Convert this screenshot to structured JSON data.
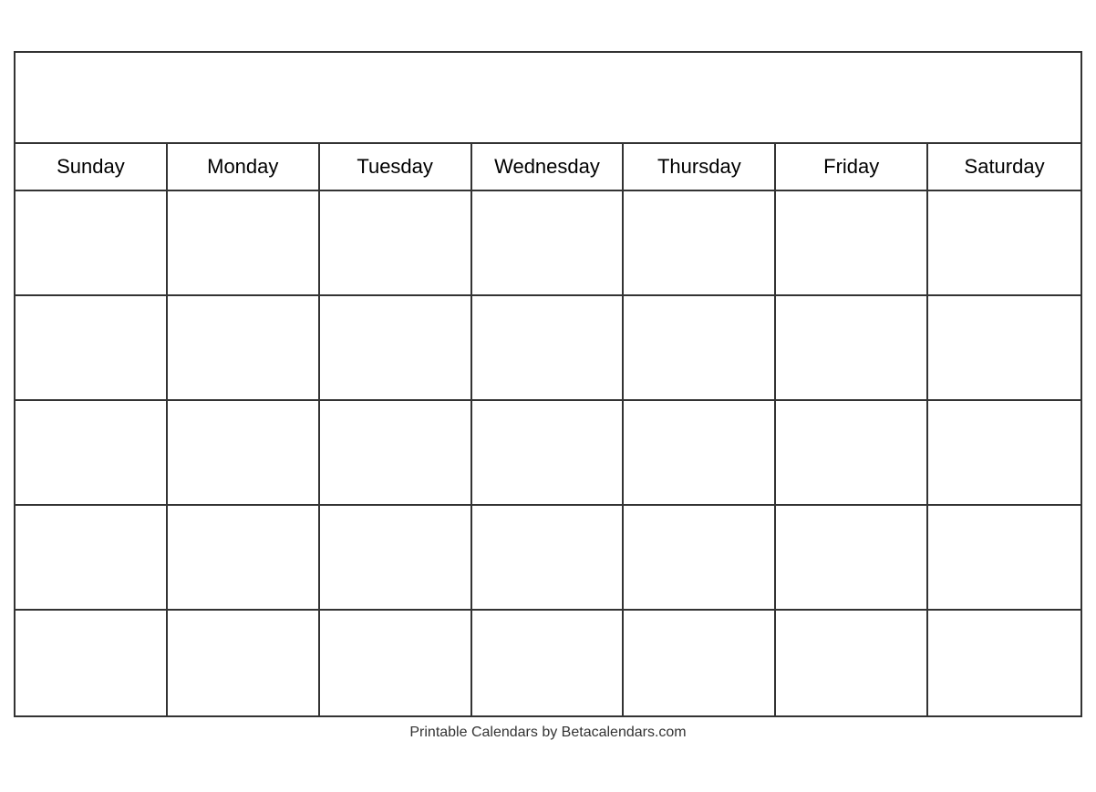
{
  "calendar": {
    "title": "",
    "days": [
      "Sunday",
      "Monday",
      "Tuesday",
      "Wednesday",
      "Thursday",
      "Friday",
      "Saturday"
    ],
    "rows": 5,
    "footer": "Printable Calendars by Betacalendars.com"
  }
}
